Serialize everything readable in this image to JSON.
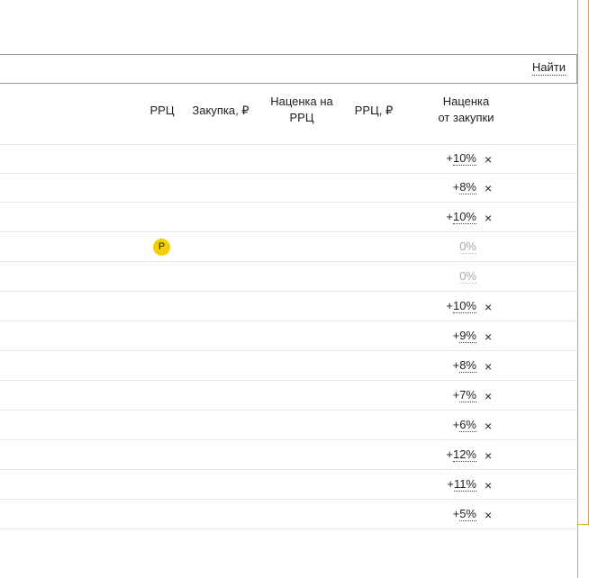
{
  "search": {
    "button_label": "Найти",
    "value": "",
    "placeholder": ""
  },
  "table": {
    "columns": {
      "rrc": "РРЦ",
      "purchase": "Закупка, ₽",
      "markup_rrc_line1": "Наценка на",
      "markup_rrc_line2": "РРЦ",
      "rrc_rub": "РРЦ, ₽",
      "markup_purchase_line1": "Наценка",
      "markup_purchase_line2": "от закупки"
    },
    "rows": [
      {
        "sign": "+",
        "value": "10%",
        "removable": true
      },
      {
        "sign": "+",
        "value": "8%",
        "removable": true
      },
      {
        "sign": "+",
        "value": "10%",
        "removable": true
      },
      {
        "sign": "",
        "value": "0%",
        "removable": false,
        "rrc_badge": "Р"
      },
      {
        "sign": "",
        "value": "0%",
        "removable": false
      },
      {
        "sign": "+",
        "value": "10%",
        "removable": true
      },
      {
        "sign": "+",
        "value": "9%",
        "removable": true
      },
      {
        "sign": "+",
        "value": "8%",
        "removable": true
      },
      {
        "sign": "+",
        "value": "7%",
        "removable": true
      },
      {
        "sign": "+",
        "value": "6%",
        "removable": true
      },
      {
        "sign": "+",
        "value": "12%",
        "removable": true
      },
      {
        "sign": "+",
        "value": "11%",
        "removable": true
      },
      {
        "sign": "+",
        "value": "5%",
        "removable": true
      }
    ],
    "remove_glyph": "×"
  },
  "colors": {
    "accent_border": "#f0a030",
    "badge": "#f5d000"
  }
}
